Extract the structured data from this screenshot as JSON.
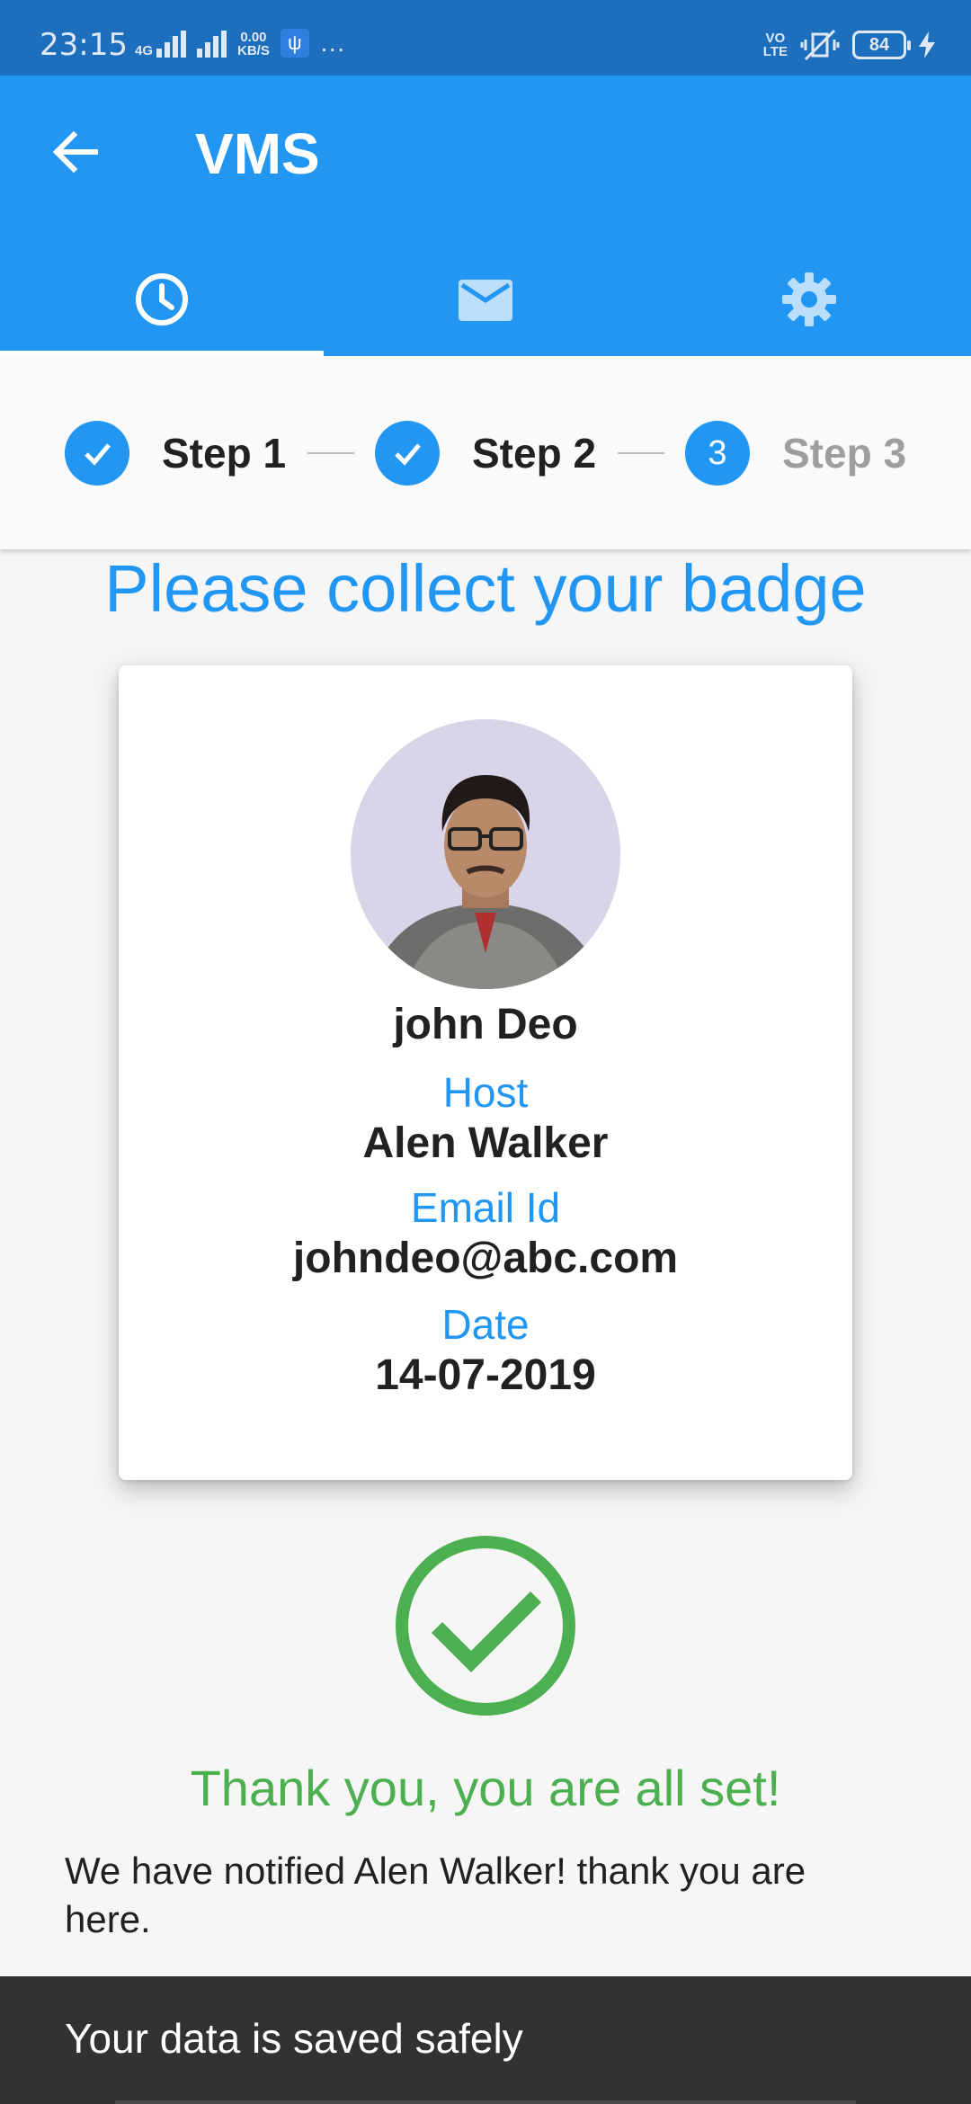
{
  "status_bar": {
    "time": "23:15",
    "network": "4G",
    "speed_value": "0.00",
    "speed_unit": "KB/S",
    "overflow": "···",
    "volte_top": "VO",
    "volte_bottom": "LTE",
    "battery": "84"
  },
  "app_bar": {
    "title": "VMS",
    "tabs": [
      {
        "icon": "clock-icon",
        "selected": true
      },
      {
        "icon": "mail-icon",
        "selected": false
      },
      {
        "icon": "gear-icon",
        "selected": false
      }
    ]
  },
  "stepper": {
    "steps": [
      {
        "label": "Step 1",
        "state": "complete"
      },
      {
        "label": "Step 2",
        "state": "complete"
      },
      {
        "label": "Step 3",
        "number": "3",
        "state": "active"
      }
    ]
  },
  "main": {
    "heading": "Please collect your badge",
    "badge": {
      "name": "john Deo",
      "host_label": "Host",
      "host_value": "Alen Walker",
      "email_label": "Email Id",
      "email_value": "johndeo@abc.com",
      "date_label": "Date",
      "date_value": "14-07-2019"
    },
    "thanks": "Thank you, you are all set!",
    "notified": "We have notified Alen Walker! thank you are here."
  },
  "snackbar": {
    "text": "Your data is saved safely"
  },
  "colors": {
    "primary": "#2196f3",
    "status_bar": "#1d6fbd",
    "success": "#4caf50",
    "snackbar": "#323232"
  }
}
